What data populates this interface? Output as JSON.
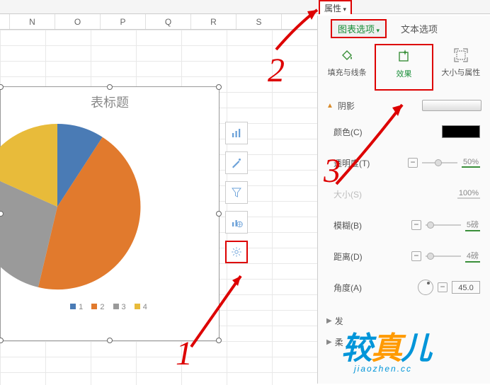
{
  "topbar": {
    "attributes": "属性"
  },
  "columns": [
    "",
    "N",
    "O",
    "P",
    "Q",
    "R",
    "S"
  ],
  "panel": {
    "tab_chart_options": "图表选项",
    "tab_text_options": "文本选项",
    "icontabs": {
      "fill": "填充与线条",
      "effect": "效果",
      "size": "大小与属性"
    },
    "shadow": {
      "label": "阴影",
      "color": "颜色(C)",
      "transparency": "透明度(T)",
      "transparency_val": "50%",
      "size": "大小(S)",
      "size_val": "100%",
      "blur": "模糊(B)",
      "blur_val": "5磅",
      "distance": "距离(D)",
      "distance_val": "4磅",
      "angle": "角度(A)",
      "angle_val": "45.0"
    },
    "expand": {
      "glow": "发",
      "soft": "柔"
    }
  },
  "chart": {
    "title": "表标题",
    "legend": [
      "1",
      "2",
      "3",
      "4"
    ]
  },
  "labels": {
    "n1": "1",
    "n2": "2",
    "n3": "3"
  },
  "watermark": {
    "line1_a": "较",
    "line1_b": "真",
    "line1_c": "儿",
    "line2": "jiaozhen.cc"
  },
  "chart_data": {
    "type": "pie",
    "title": "表标题",
    "categories": [
      "1",
      "2",
      "3",
      "4"
    ],
    "values": [
      9,
      52,
      27,
      12
    ],
    "colors": [
      "#4a7bb5",
      "#e17a2d",
      "#9a9a9a",
      "#e8bb3a"
    ]
  }
}
